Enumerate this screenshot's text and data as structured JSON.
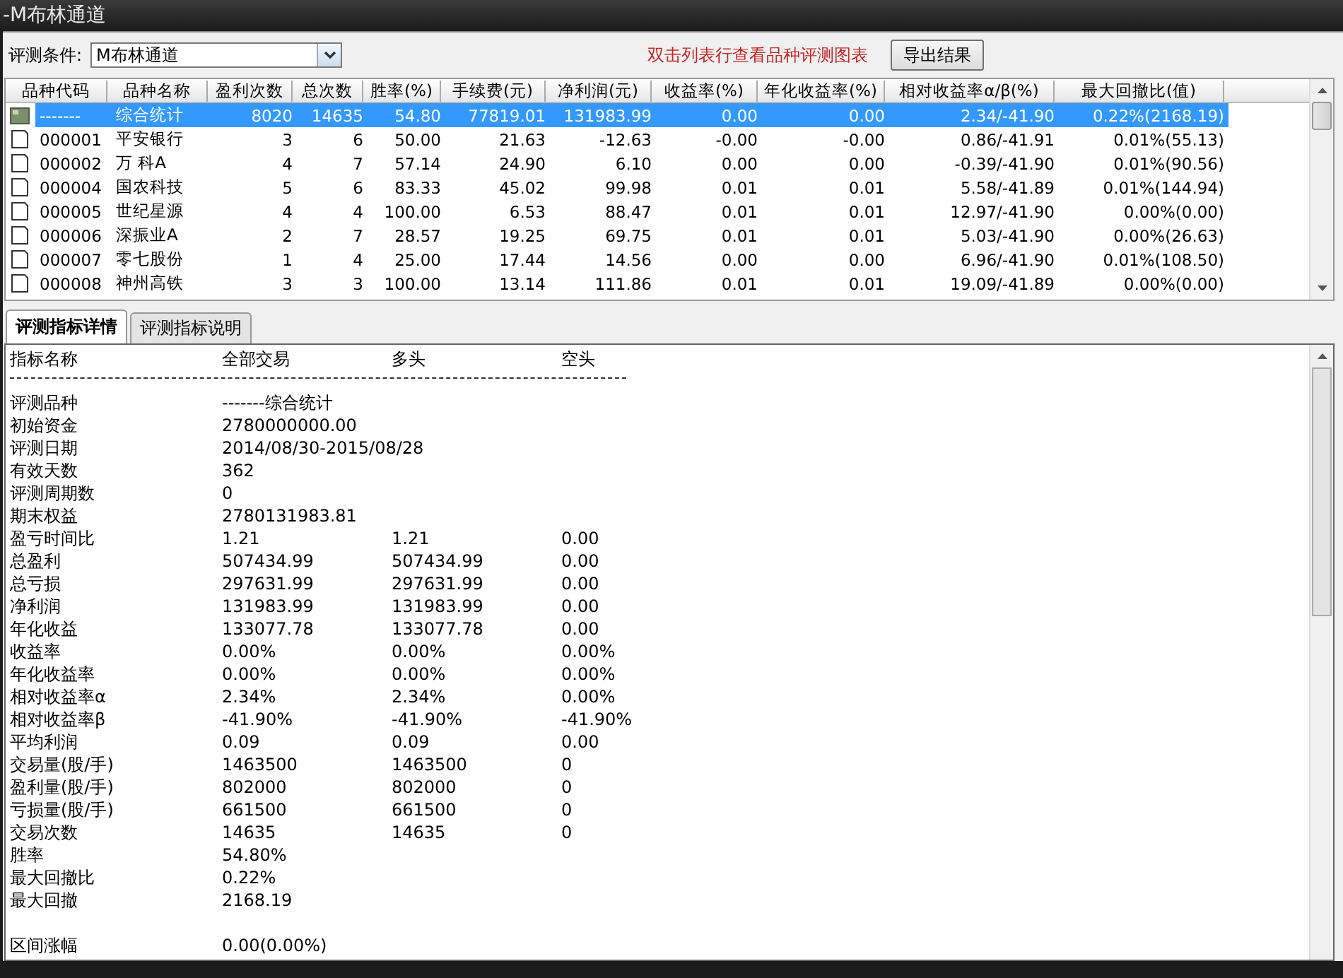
{
  "window": {
    "title": "-M布林通道"
  },
  "toolbar": {
    "condition_label": "评测条件:",
    "condition_value": "M布林通道",
    "hint": "双击列表行查看品种评测图表",
    "export_button": "导出结果"
  },
  "table": {
    "columns": [
      "品种代码",
      "品种名称",
      "盈利次数",
      "总次数",
      "胜率(%)",
      "手续费(元)",
      "净利润(元)",
      "收益率(%)",
      "年化收益率(%)",
      "相对收益率α/β(%)",
      "最大回撤比(值)"
    ],
    "rows": [
      {
        "kind": "summary",
        "selected": true,
        "cells": [
          "-------",
          "综合统计",
          "8020",
          "14635",
          "54.80",
          "77819.01",
          "131983.99",
          "0.00",
          "0.00",
          "2.34/-41.90",
          "0.22%(2168.19)"
        ]
      },
      {
        "kind": "stock",
        "selected": false,
        "cells": [
          "000001",
          "平安银行",
          "3",
          "6",
          "50.00",
          "21.63",
          "-12.63",
          "-0.00",
          "-0.00",
          "0.86/-41.91",
          "0.01%(55.13)"
        ]
      },
      {
        "kind": "stock",
        "selected": false,
        "cells": [
          "000002",
          "万  科A",
          "4",
          "7",
          "57.14",
          "24.90",
          "6.10",
          "0.00",
          "0.00",
          "-0.39/-41.90",
          "0.01%(90.56)"
        ]
      },
      {
        "kind": "stock",
        "selected": false,
        "cells": [
          "000004",
          "国农科技",
          "5",
          "6",
          "83.33",
          "45.02",
          "99.98",
          "0.01",
          "0.01",
          "5.58/-41.89",
          "0.01%(144.94)"
        ]
      },
      {
        "kind": "stock",
        "selected": false,
        "cells": [
          "000005",
          "世纪星源",
          "4",
          "4",
          "100.00",
          "6.53",
          "88.47",
          "0.01",
          "0.01",
          "12.97/-41.90",
          "0.00%(0.00)"
        ]
      },
      {
        "kind": "stock",
        "selected": false,
        "cells": [
          "000006",
          "深振业A",
          "2",
          "7",
          "28.57",
          "19.25",
          "69.75",
          "0.01",
          "0.01",
          "5.03/-41.90",
          "0.00%(26.63)"
        ]
      },
      {
        "kind": "stock",
        "selected": false,
        "cells": [
          "000007",
          "零七股份",
          "1",
          "4",
          "25.00",
          "17.44",
          "14.56",
          "0.00",
          "0.00",
          "6.96/-41.90",
          "0.01%(108.50)"
        ]
      },
      {
        "kind": "stock",
        "selected": false,
        "cells": [
          "000008",
          "神州高铁",
          "3",
          "3",
          "100.00",
          "13.14",
          "111.86",
          "0.01",
          "0.01",
          "19.09/-41.89",
          "0.00%(0.00)"
        ]
      }
    ]
  },
  "tabs": [
    {
      "label": "评测指标详情",
      "selected": true
    },
    {
      "label": "评测指标说明",
      "selected": false
    }
  ],
  "details": {
    "columns": [
      "指标名称",
      "全部交易",
      "多头",
      "空头"
    ],
    "rows": [
      {
        "kind": "value",
        "cells": [
          "评测品种",
          "-------综合统计"
        ]
      },
      {
        "kind": "value",
        "cells": [
          "初始资金",
          "2780000000.00"
        ]
      },
      {
        "kind": "value",
        "cells": [
          "评测日期",
          "2014/08/30-2015/08/28"
        ]
      },
      {
        "kind": "value",
        "cells": [
          "有效天数",
          "362"
        ]
      },
      {
        "kind": "value",
        "cells": [
          "评测周期数",
          "0"
        ]
      },
      {
        "kind": "value",
        "cells": [
          "期末权益",
          "2780131983.81"
        ]
      },
      {
        "kind": "value",
        "cells": [
          "盈亏时间比",
          "1.21",
          "1.21",
          "0.00"
        ]
      },
      {
        "kind": "value",
        "cells": [
          "总盈利",
          "507434.99",
          "507434.99",
          "0.00"
        ]
      },
      {
        "kind": "value",
        "cells": [
          "总亏损",
          "297631.99",
          "297631.99",
          "0.00"
        ]
      },
      {
        "kind": "value",
        "cells": [
          "净利润",
          "131983.99",
          "131983.99",
          "0.00"
        ]
      },
      {
        "kind": "value",
        "cells": [
          "年化收益",
          "133077.78",
          "133077.78",
          "0.00"
        ]
      },
      {
        "kind": "value",
        "cells": [
          "收益率",
          "0.00%",
          "0.00%",
          "0.00%"
        ]
      },
      {
        "kind": "value",
        "cells": [
          "年化收益率",
          "0.00%",
          "0.00%",
          "0.00%"
        ]
      },
      {
        "kind": "value",
        "cells": [
          "相对收益率α",
          "2.34%",
          "2.34%",
          "0.00%"
        ]
      },
      {
        "kind": "value",
        "cells": [
          "相对收益率β",
          "-41.90%",
          "-41.90%",
          "-41.90%"
        ]
      },
      {
        "kind": "value",
        "cells": [
          "平均利润",
          "0.09",
          "0.09",
          "0.00"
        ]
      },
      {
        "kind": "value",
        "cells": [
          "交易量(股/手)",
          "1463500",
          "1463500",
          "0"
        ]
      },
      {
        "kind": "value",
        "cells": [
          "盈利量(股/手)",
          "802000",
          "802000",
          "0"
        ]
      },
      {
        "kind": "value",
        "cells": [
          "亏损量(股/手)",
          "661500",
          "661500",
          "0"
        ]
      },
      {
        "kind": "value",
        "cells": [
          "交易次数",
          "14635",
          "14635",
          "0"
        ]
      },
      {
        "kind": "value",
        "cells": [
          "胜率",
          "54.80%"
        ]
      },
      {
        "kind": "value",
        "cells": [
          "最大回撤比",
          "0.22%"
        ]
      },
      {
        "kind": "value",
        "cells": [
          "最大回撤",
          "2168.19"
        ]
      },
      {
        "kind": "blank"
      },
      {
        "kind": "value",
        "cells": [
          "区间涨幅",
          "0.00(0.00%)"
        ]
      }
    ]
  }
}
